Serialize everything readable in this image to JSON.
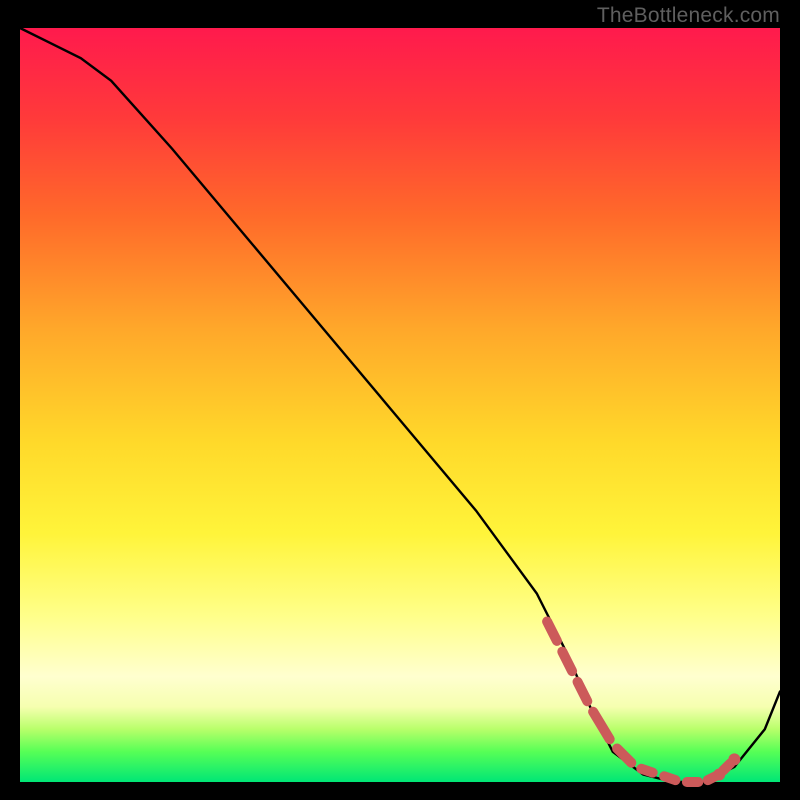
{
  "watermark": "TheBottleneck.com",
  "chart_data": {
    "type": "line",
    "title": "",
    "xlabel": "",
    "ylabel": "",
    "xlim": [
      0,
      100
    ],
    "ylim": [
      0,
      100
    ],
    "grid": false,
    "legend": false,
    "series": [
      {
        "name": "curve",
        "x": [
          0,
          4,
          8,
          12,
          20,
          30,
          40,
          50,
          60,
          68,
          72,
          75,
          78,
          82,
          86,
          90,
          94,
          98,
          100
        ],
        "y": [
          100,
          98,
          96,
          93,
          84,
          72,
          60,
          48,
          36,
          25,
          17,
          10,
          4,
          1,
          0,
          0,
          2,
          7,
          12
        ]
      }
    ],
    "highlighted_segment": {
      "name": "dashed-markers",
      "x": [
        69,
        71,
        73,
        75,
        78,
        81,
        84,
        87,
        90,
        92,
        94
      ],
      "y": [
        22,
        18,
        14,
        10,
        5,
        2,
        1,
        0,
        0,
        1,
        3
      ]
    },
    "colors": {
      "curve": "#000000",
      "markers": "#cc5a5a",
      "gradient_top": "#ff1a4d",
      "gradient_mid": "#ffe640",
      "gradient_bottom": "#00e676"
    }
  }
}
